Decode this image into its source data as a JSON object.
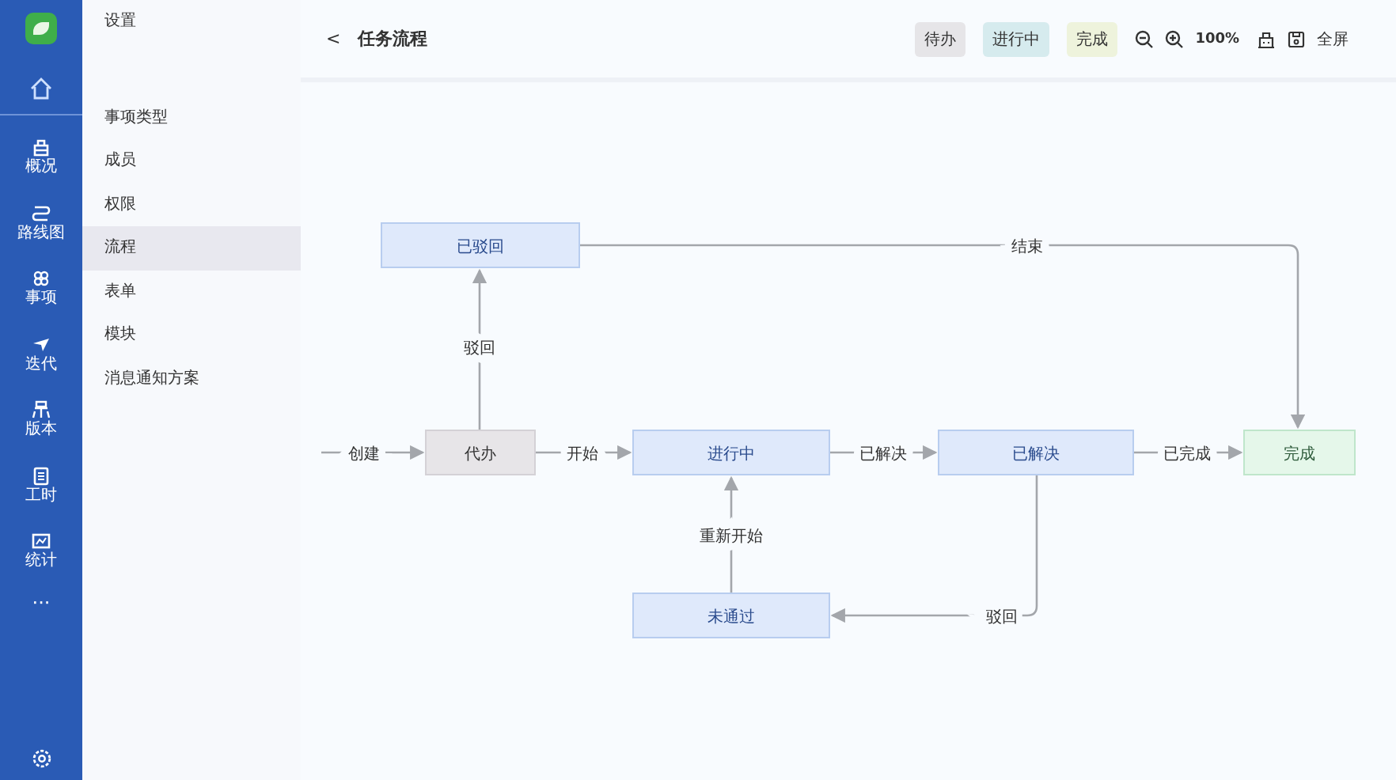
{
  "rail": {
    "items": [
      {
        "label": "概况"
      },
      {
        "label": "路线图"
      },
      {
        "label": "事项"
      },
      {
        "label": "迭代"
      },
      {
        "label": "版本"
      },
      {
        "label": "工时"
      },
      {
        "label": "统计"
      }
    ],
    "more": "···"
  },
  "settings_nav": {
    "title": "设置",
    "items": [
      {
        "label": "事项类型",
        "selected": false
      },
      {
        "label": "成员",
        "selected": false
      },
      {
        "label": "权限",
        "selected": false
      },
      {
        "label": "流程",
        "selected": true
      },
      {
        "label": "表单",
        "selected": false
      },
      {
        "label": "模块",
        "selected": false
      },
      {
        "label": "消息通知方案",
        "selected": false
      }
    ]
  },
  "header": {
    "back": "<",
    "title": "任务流程",
    "legend": [
      {
        "label": "待办",
        "kind": "todo"
      },
      {
        "label": "进行中",
        "kind": "progress"
      },
      {
        "label": "完成",
        "kind": "done"
      }
    ],
    "zoom": "100%",
    "fullscreen": "全屏"
  },
  "workflow": {
    "nodes": [
      {
        "label": "已驳回",
        "kind": "progress"
      },
      {
        "label": "代办",
        "kind": "todo"
      },
      {
        "label": "进行中",
        "kind": "progress"
      },
      {
        "label": "已解决",
        "kind": "progress"
      },
      {
        "label": "完成",
        "kind": "done"
      },
      {
        "label": "未通过",
        "kind": "progress"
      }
    ],
    "edges": [
      {
        "label": "创建"
      },
      {
        "label": "驳回"
      },
      {
        "label": "开始"
      },
      {
        "label": "已解决"
      },
      {
        "label": "已完成"
      },
      {
        "label": "结束"
      },
      {
        "label": "驳回"
      },
      {
        "label": "重新开始"
      }
    ]
  }
}
